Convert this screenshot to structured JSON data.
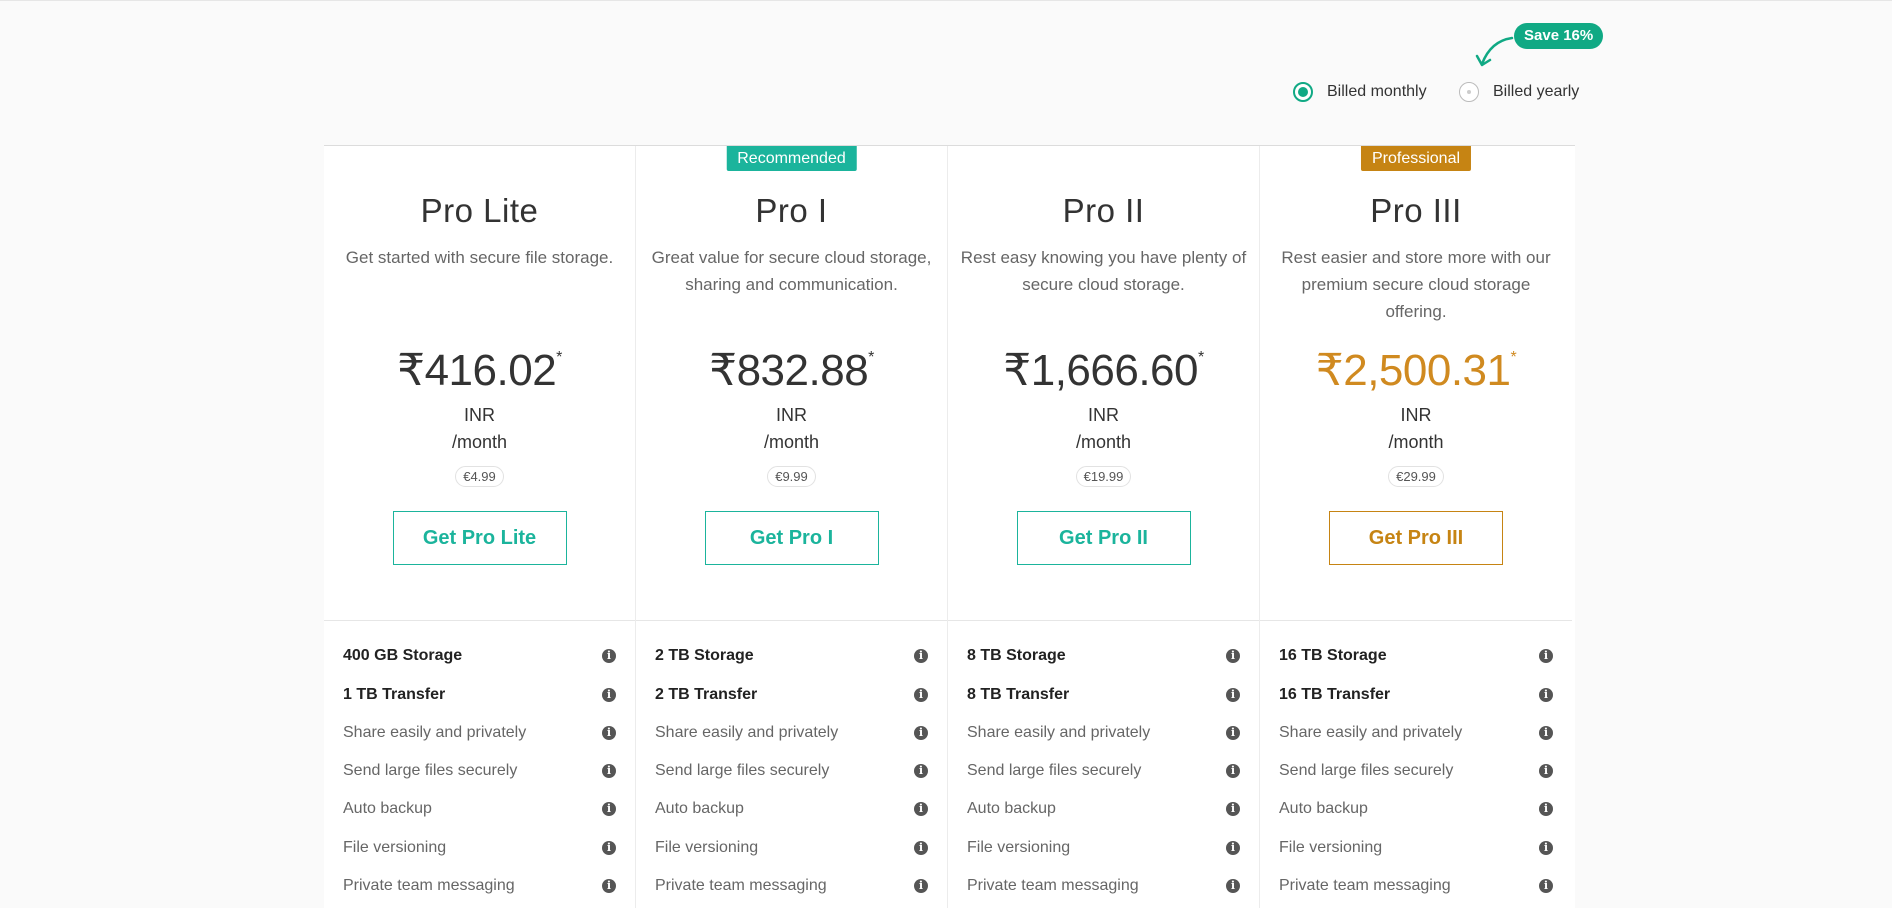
{
  "billing": {
    "save_badge": "Save 16%",
    "monthly_label": "Billed monthly",
    "yearly_label": "Billed yearly",
    "selected": "monthly"
  },
  "colors": {
    "accent": "#1bb49c",
    "toggle": "#10a984",
    "professional": "#c68413"
  },
  "plans": [
    {
      "badge": "",
      "name": "Pro Lite",
      "description": "Get started with secure file storage.",
      "price": "₹416.02",
      "asterisk": "*",
      "currency": "INR",
      "period": "/month",
      "euro": "€4.99",
      "cta": "Get Pro Lite",
      "features": [
        {
          "label": "400 GB Storage",
          "icon": "info-icon"
        },
        {
          "label": "1 TB Transfer",
          "icon": "info-icon"
        },
        {
          "label": "Share easily and privately",
          "icon": "info-icon"
        },
        {
          "label": "Send large files securely",
          "icon": "info-icon"
        },
        {
          "label": "Auto backup",
          "icon": "info-icon"
        },
        {
          "label": "File versioning",
          "icon": "info-icon"
        },
        {
          "label": "Private team messaging",
          "icon": "info-icon"
        }
      ]
    },
    {
      "badge": "Recommended",
      "name": "Pro I",
      "description": "Great value for secure cloud storage, sharing and communication.",
      "price": "₹832.88",
      "asterisk": "*",
      "currency": "INR",
      "period": "/month",
      "euro": "€9.99",
      "cta": "Get Pro I",
      "features": [
        {
          "label": "2 TB Storage",
          "icon": "info-icon"
        },
        {
          "label": "2 TB Transfer",
          "icon": "info-icon"
        },
        {
          "label": "Share easily and privately",
          "icon": "info-icon"
        },
        {
          "label": "Send large files securely",
          "icon": "info-icon"
        },
        {
          "label": "Auto backup",
          "icon": "info-icon"
        },
        {
          "label": "File versioning",
          "icon": "info-icon"
        },
        {
          "label": "Private team messaging",
          "icon": "info-icon"
        }
      ]
    },
    {
      "badge": "",
      "name": "Pro II",
      "description": "Rest easy knowing you have plenty of secure cloud storage.",
      "price": "₹1,666.60",
      "asterisk": "*",
      "currency": "INR",
      "period": "/month",
      "euro": "€19.99",
      "cta": "Get Pro II",
      "features": [
        {
          "label": "8 TB Storage",
          "icon": "info-icon"
        },
        {
          "label": "8 TB Transfer",
          "icon": "info-icon"
        },
        {
          "label": "Share easily and privately",
          "icon": "info-icon"
        },
        {
          "label": "Send large files securely",
          "icon": "info-icon"
        },
        {
          "label": "Auto backup",
          "icon": "info-icon"
        },
        {
          "label": "File versioning",
          "icon": "info-icon"
        },
        {
          "label": "Private team messaging",
          "icon": "info-icon"
        }
      ]
    },
    {
      "badge": "Professional",
      "name": "Pro III",
      "description": "Rest easier and store more with our premium secure cloud storage offering.",
      "price": "₹2,500.31",
      "asterisk": "*",
      "currency": "INR",
      "period": "/month",
      "euro": "€29.99",
      "cta": "Get Pro III",
      "features": [
        {
          "label": "16 TB Storage",
          "icon": "info-icon"
        },
        {
          "label": "16 TB Transfer",
          "icon": "info-icon"
        },
        {
          "label": "Share easily and privately",
          "icon": "info-icon"
        },
        {
          "label": "Send large files securely",
          "icon": "info-icon"
        },
        {
          "label": "Auto backup",
          "icon": "info-icon"
        },
        {
          "label": "File versioning",
          "icon": "info-icon"
        },
        {
          "label": "Private team messaging",
          "icon": "info-icon"
        }
      ]
    }
  ]
}
